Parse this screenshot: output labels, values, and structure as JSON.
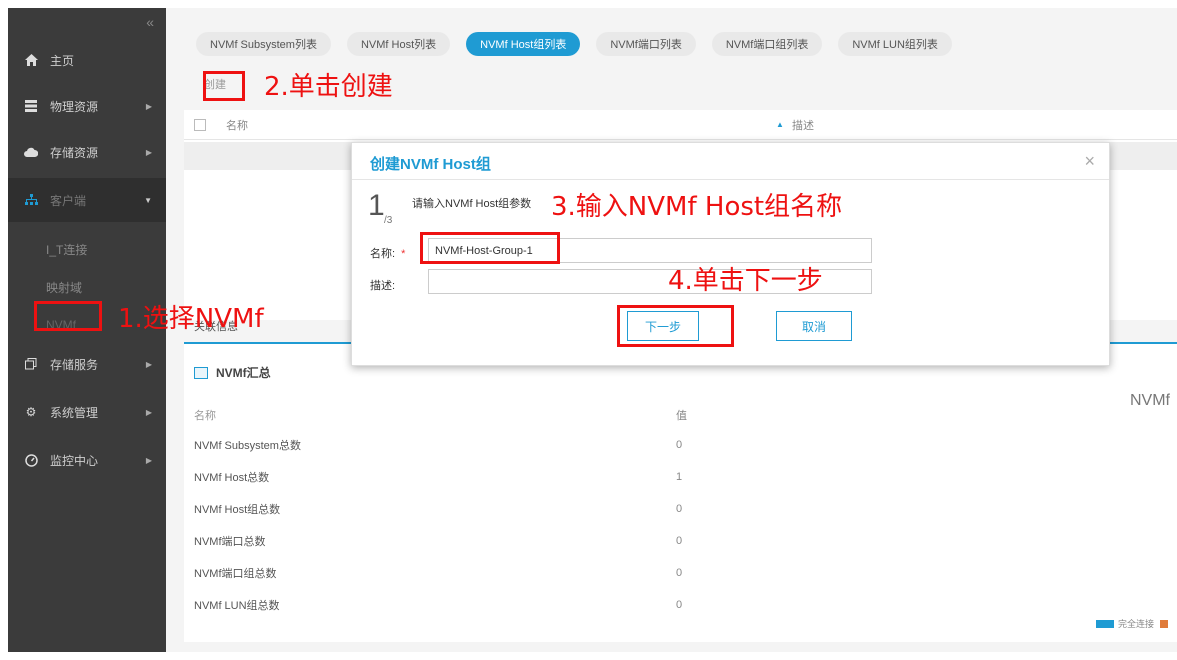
{
  "sidebar": {
    "collapse_glyph": "«",
    "items": [
      {
        "label": "主页",
        "icon": "home-icon"
      },
      {
        "label": "物理资源",
        "icon": "server-icon"
      },
      {
        "label": "存储资源",
        "icon": "cloud-icon"
      },
      {
        "label": "客户端",
        "icon": "sitemap-icon"
      },
      {
        "label": "存储服务",
        "icon": "copy-icon"
      },
      {
        "label": "系统管理",
        "icon": "gear-icon"
      },
      {
        "label": "监控中心",
        "icon": "dashboard-icon"
      }
    ],
    "sub_items": [
      "I_T连接",
      "映射域",
      "NVMf"
    ]
  },
  "tabs": [
    "NVMf Subsystem列表",
    "NVMf Host列表",
    "NVMf Host组列表",
    "NVMf端口列表",
    "NVMf端口组列表",
    "NVMf LUN组列表"
  ],
  "active_tab": 2,
  "toolbar": {
    "create_label": "创建"
  },
  "list": {
    "col_name": "名称",
    "col_desc": "描述"
  },
  "summary": {
    "title": "NVMf汇总",
    "head_name": "名称",
    "head_value": "值",
    "rows": [
      {
        "name": "NVMf Subsystem总数",
        "value": "0"
      },
      {
        "name": "NVMf Host总数",
        "value": "1"
      },
      {
        "name": "NVMf Host组总数",
        "value": "0"
      },
      {
        "name": "NVMf端口总数",
        "value": "0"
      },
      {
        "name": "NVMf端口组总数",
        "value": "0"
      },
      {
        "name": "NVMf LUN组总数",
        "value": "0"
      }
    ],
    "right_title": "NVMf",
    "legend_label": "完全连接",
    "hidden_label": "关联信息"
  },
  "dialog": {
    "title": "创建NVMf Host组",
    "step": "1",
    "step_total": "/3",
    "hint": "请输入NVMf Host组参数",
    "name_label": "名称:",
    "required_mark": "*",
    "name_value": "NVMf-Host-Group-1",
    "desc_label": "描述:",
    "desc_value": "",
    "next_label": "下一步",
    "cancel_label": "取消",
    "close_glyph": "×"
  },
  "annotations": {
    "a1": "1.选择NVMf",
    "a2": "2.单击创建",
    "a3": "3.输入NVMf Host组名称",
    "a4": "4.单击下一步"
  },
  "colors": {
    "accent": "#1f9bd3",
    "annotation": "#e11111",
    "sidebar": "#3b3b3b"
  }
}
